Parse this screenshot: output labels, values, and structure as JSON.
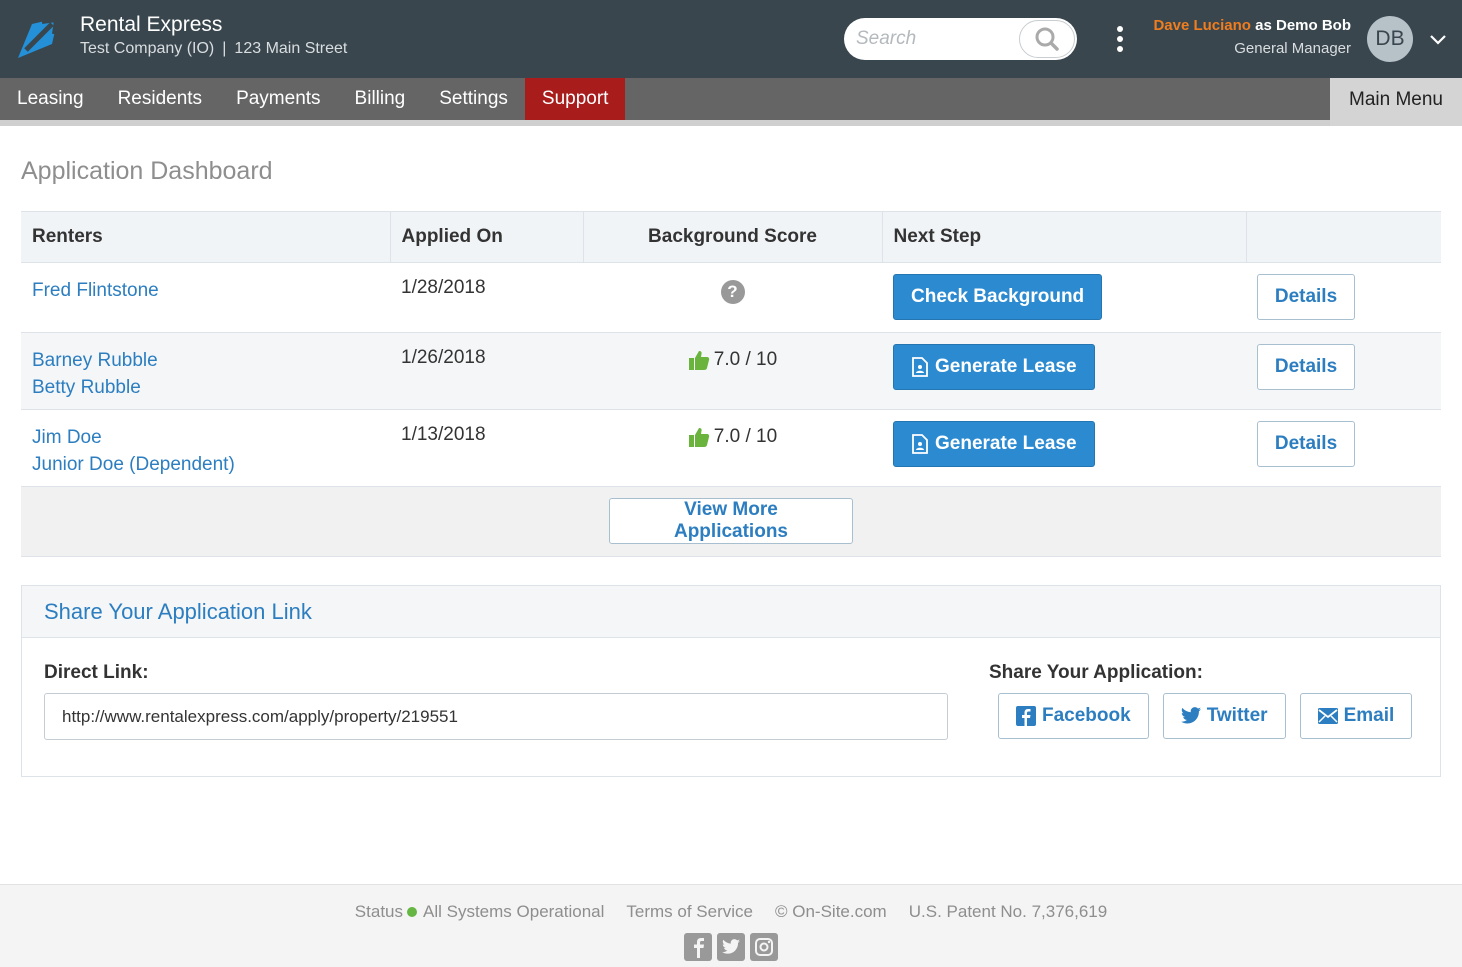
{
  "header": {
    "brand_title": "Rental Express",
    "company": "Test Company (IO)",
    "separator": "|",
    "address": "123 Main Street",
    "search_placeholder": "Search",
    "user_real": "Dave Luciano",
    "user_as": " as Demo Bob",
    "user_role": "General Manager",
    "avatar_initials": "DB"
  },
  "nav": {
    "items": [
      "Leasing",
      "Residents",
      "Payments",
      "Billing",
      "Settings",
      "Support"
    ],
    "active": "Support",
    "main_menu": "Main Menu"
  },
  "page": {
    "title": "Application Dashboard"
  },
  "table": {
    "headers": [
      "Renters",
      "Applied On",
      "Background Score",
      "Next Step",
      ""
    ],
    "rows": [
      {
        "renters": [
          "Fred Flintstone"
        ],
        "applied_on": "1/28/2018",
        "score": "?",
        "next_step": "Check Background",
        "details": "Details"
      },
      {
        "renters": [
          "Barney Rubble",
          "Betty Rubble"
        ],
        "applied_on": "1/26/2018",
        "score": "7.0 / 10",
        "next_step": "Generate Lease",
        "details": "Details"
      },
      {
        "renters": [
          "Jim Doe",
          "Junior Doe (Dependent)"
        ],
        "applied_on": "1/13/2018",
        "score": "7.0 / 10",
        "next_step": "Generate Lease",
        "details": "Details"
      }
    ],
    "view_more": "View More Applications"
  },
  "share": {
    "title": "Share Your Application Link",
    "direct_label": "Direct Link:",
    "direct_value": "http://www.rentalexpress.com/apply/property/219551",
    "share_label": "Share Your Application:",
    "facebook": "Facebook",
    "twitter": "Twitter",
    "email": "Email"
  },
  "footer": {
    "status_label": "Status",
    "status_text": "All Systems Operational",
    "terms": "Terms of Service",
    "copyright": "© On-Site.com",
    "patent": "U.S. Patent No. 7,376,619"
  },
  "colors": {
    "header_bg": "#39464e",
    "nav_bg": "#656565",
    "active_tab": "#a81c1c",
    "link": "#2c7ec0",
    "primary_button": "#2c8bd0",
    "user_highlight": "#f07d1e",
    "status_ok": "#65b643",
    "thumb_up": "#6ab43e"
  }
}
